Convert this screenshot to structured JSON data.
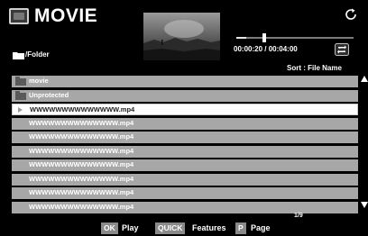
{
  "header": {
    "title": "MOVIE",
    "app_icon": "movie-screen-icon",
    "refresh_icon": "refresh-icon"
  },
  "player": {
    "time": "00:00:20 / 00:04:00",
    "progress_fraction": 0.083,
    "repeat_icon": "repeat-icon"
  },
  "folder": {
    "path": "/Folder"
  },
  "sort": {
    "label": "Sort : File Name"
  },
  "list": {
    "items": [
      {
        "label": "movie",
        "type": "folder"
      },
      {
        "label": "Unprotected",
        "type": "folder"
      },
      {
        "label": "WWWWWWWWWWWWWW.mp4",
        "type": "file",
        "selected": true
      },
      {
        "label": "WWWWWWWWWWWWWW.mp4",
        "type": "file"
      },
      {
        "label": "WWWWWWWWWWWWWW.mp4",
        "type": "file"
      },
      {
        "label": "WWWWWWWWWWWWWW.mp4",
        "type": "file"
      },
      {
        "label": "WWWWWWWWWWWWWW.mp4",
        "type": "file"
      },
      {
        "label": "WWWWWWWWWWWWWW.mp4",
        "type": "file"
      },
      {
        "label": "WWWWWWWWWWWWWW.mp4",
        "type": "file"
      },
      {
        "label": "WWWWWWWWWWWWWW.mp4",
        "type": "file"
      }
    ],
    "page": "1/9"
  },
  "footer": {
    "ok_key": "OK",
    "ok_label": "Play",
    "quick_key": "QUICK",
    "quick_label": "Features",
    "p_key": "P",
    "p_label": "Page"
  },
  "colors": {
    "background": "#000000",
    "row": "#a7a7a7",
    "row_selected": "#ffffff",
    "key": "#8a8a8a"
  }
}
